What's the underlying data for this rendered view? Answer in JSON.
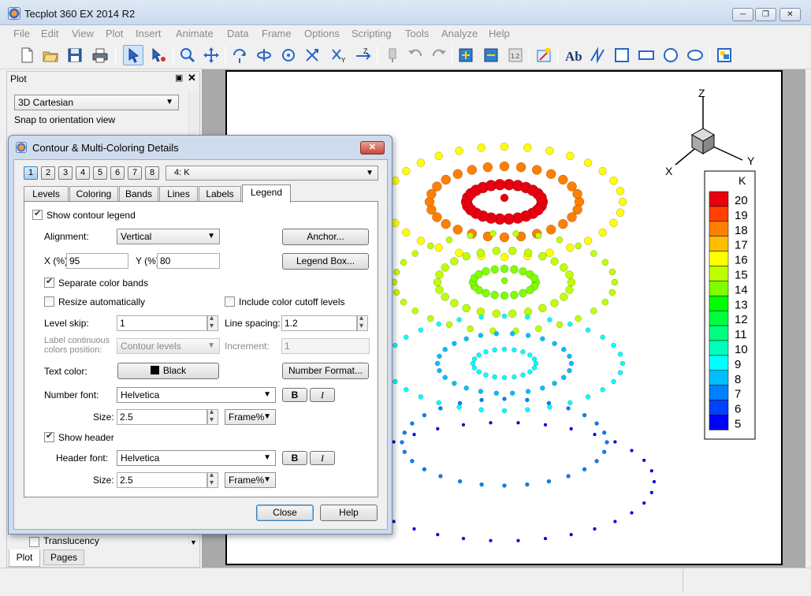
{
  "window": {
    "title": "Tecplot 360 EX 2014 R2"
  },
  "menu": [
    "File",
    "Edit",
    "View",
    "Plot",
    "Insert",
    "Animate",
    "Data",
    "Frame",
    "Options",
    "Scripting",
    "Tools",
    "Analyze",
    "Help"
  ],
  "toolbar": {
    "icons": [
      "new-file-icon",
      "open-file-icon",
      "save-icon",
      "print-icon",
      "select-arrow-icon",
      "adjustor-icon",
      "zoom-icon",
      "translate-icon",
      "rotate-icon",
      "spherical-rotate-icon",
      "rollerball-rotate-icon",
      "twist-icon",
      "rotate-x-icon",
      "rotate-z-icon",
      "probe-icon",
      "undo-icon",
      "redo-icon",
      "add-zone-icon",
      "delete-zone-icon",
      "slice-icon",
      "value-blanking-icon",
      "text-icon",
      "polyline-icon",
      "square-icon",
      "rectangle-icon",
      "circle-icon",
      "ellipse-icon",
      "frame-icon"
    ]
  },
  "plot_panel": {
    "title": "Plot",
    "plot_type": "3D Cartesian",
    "snap_label": "Snap to orientation view",
    "translucency_label": "Translucency",
    "tabs": {
      "plot": "Plot",
      "pages": "Pages"
    }
  },
  "dialog": {
    "title": "Contour & Multi-Coloring Details",
    "group_tabs": [
      "1",
      "2",
      "3",
      "4",
      "5",
      "6",
      "7",
      "8"
    ],
    "variable": "4: K",
    "tabs": [
      "Levels",
      "Coloring",
      "Bands",
      "Lines",
      "Labels",
      "Legend"
    ],
    "active_tab": "Legend",
    "legend": {
      "show_contour_legend": "Show contour legend",
      "alignment_label": "Alignment:",
      "alignment_value": "Vertical",
      "anchor_button": "Anchor...",
      "x_label": "X (%):",
      "x_value": "95",
      "y_label": "Y (%):",
      "y_value": "80",
      "legend_box_button": "Legend Box...",
      "separate_color_bands": "Separate color bands",
      "resize_automatically": "Resize automatically",
      "include_cutoff": "Include color cutoff levels",
      "level_skip_label": "Level skip:",
      "level_skip_value": "1",
      "line_spacing_label": "Line spacing:",
      "line_spacing_value": "1.2",
      "label_continuous_1": "Label continuous",
      "label_continuous_2": "colors position:",
      "label_continuous_value": "Contour levels",
      "increment_label": "Increment:",
      "increment_value": "1",
      "text_color_label": "Text color:",
      "text_color_value": "Black",
      "number_format_button": "Number Format...",
      "number_font_label": "Number font:",
      "number_font_value": "Helvetica",
      "bold_label": "B",
      "italic_label": "I",
      "size_label": "Size:",
      "number_size_value": "2.5",
      "size_unit": "Frame%",
      "show_header": "Show header",
      "header_font_label": "Header font:",
      "header_font_value": "Helvetica",
      "header_size_value": "2.5"
    },
    "close_button": "Close",
    "help_button": "Help"
  },
  "axes": {
    "z": "Z",
    "y": "Y",
    "x": "X"
  },
  "legend_widget": {
    "header": "K",
    "levels": [
      "20",
      "19",
      "18",
      "17",
      "16",
      "15",
      "14",
      "13",
      "12",
      "11",
      "10",
      "9",
      "8",
      "7",
      "6",
      "5"
    ],
    "colors": [
      "#e8000e",
      "#ff4000",
      "#ff7f00",
      "#ffbf00",
      "#ffff00",
      "#bfff00",
      "#7fff00",
      "#00ff00",
      "#00ff40",
      "#00ff80",
      "#00ffbf",
      "#00ffff",
      "#00bfff",
      "#0080ff",
      "#0040ff",
      "#0000ff"
    ]
  }
}
